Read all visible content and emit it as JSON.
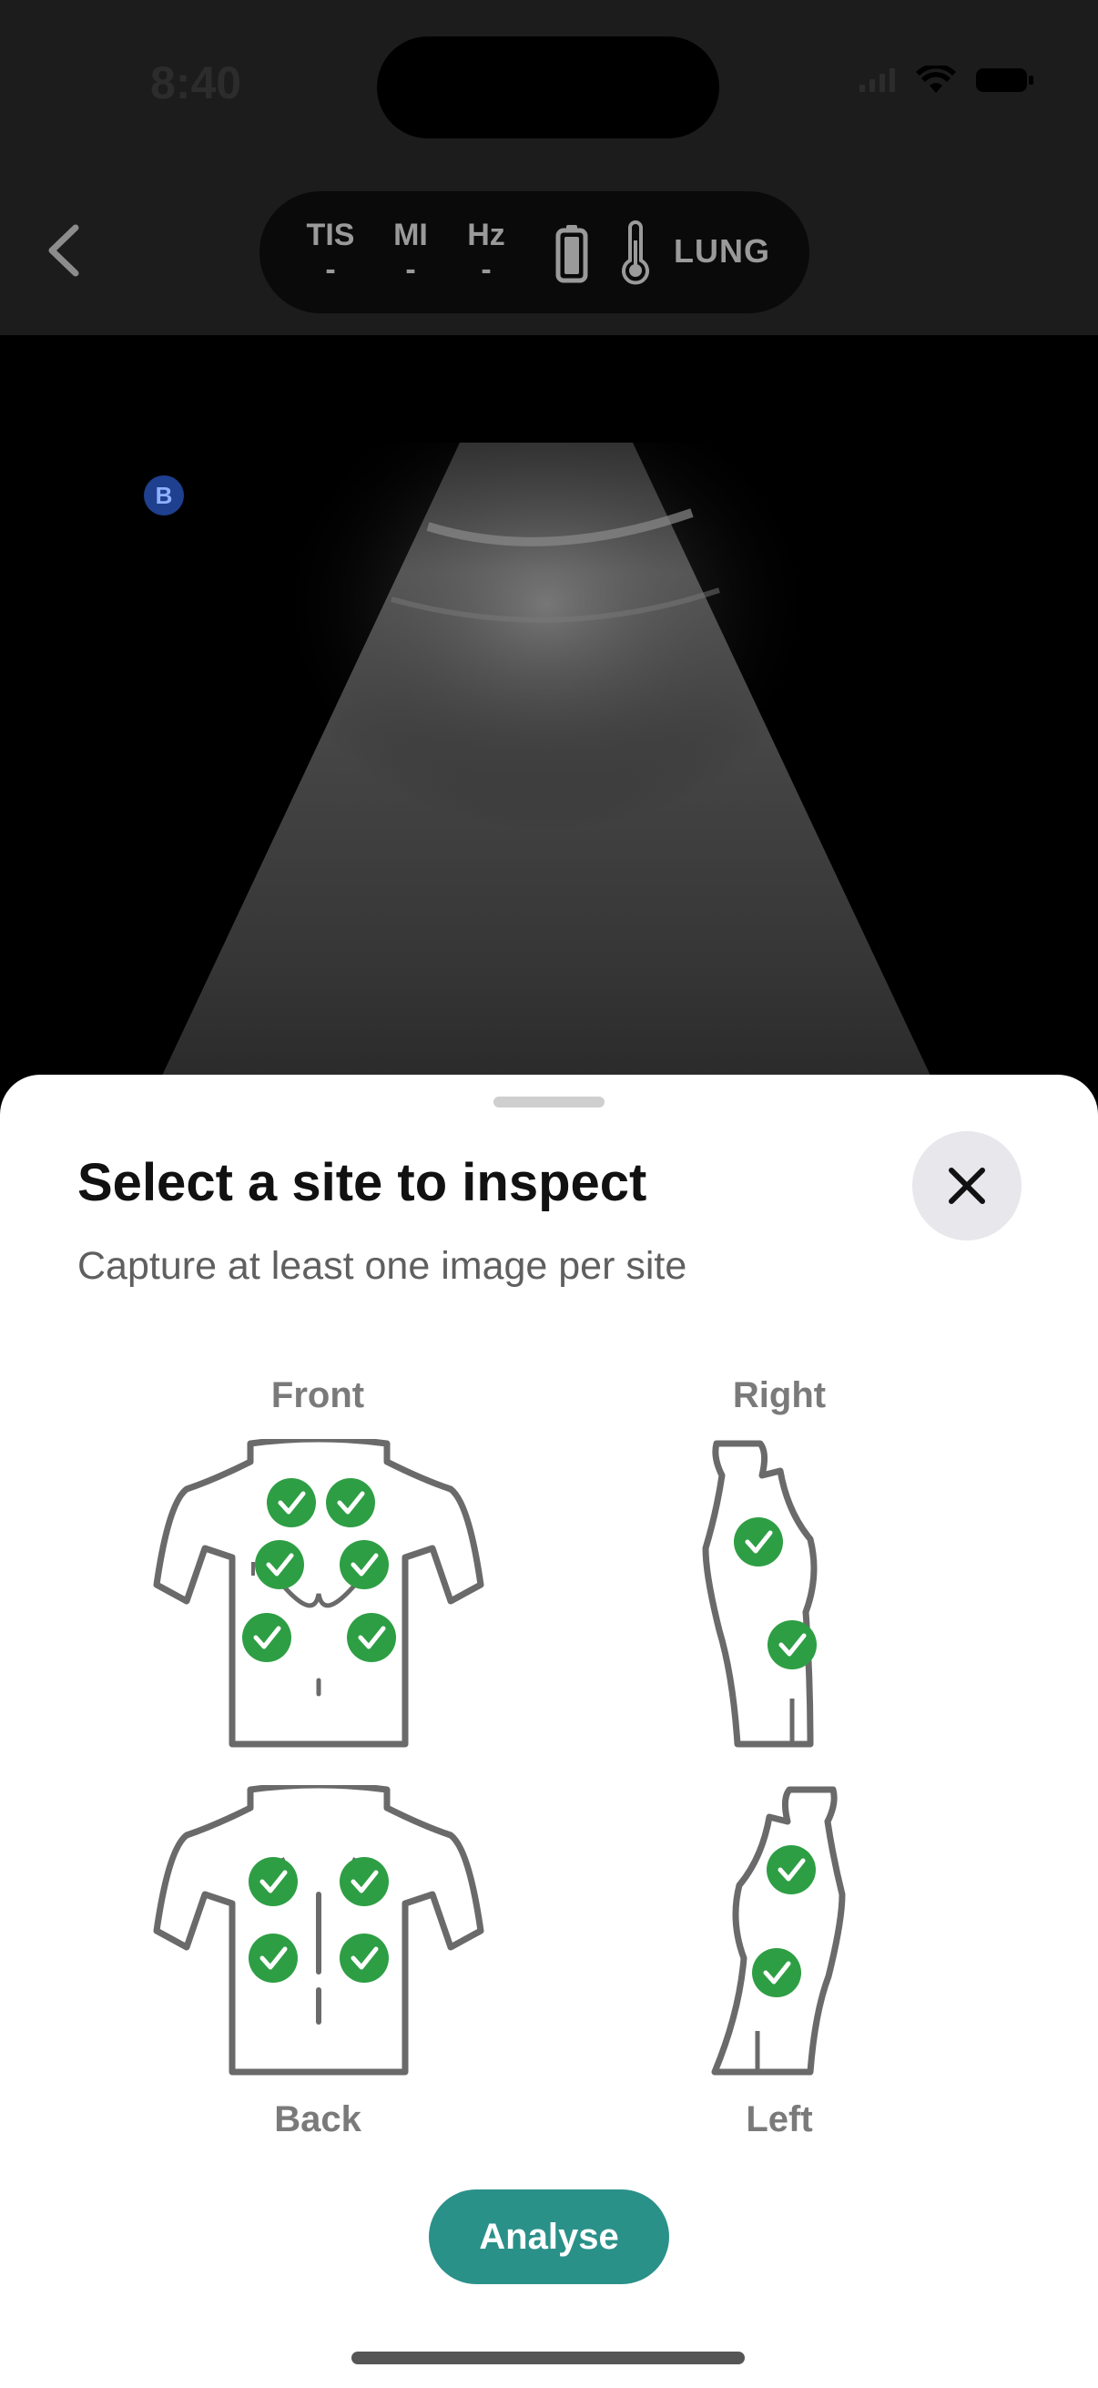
{
  "status_bar": {
    "time": "8:40",
    "icons": [
      "signal-icon",
      "wifi-icon",
      "battery-icon"
    ]
  },
  "header": {
    "metrics": [
      {
        "label": "TIS",
        "value": "-"
      },
      {
        "label": "MI",
        "value": "-"
      },
      {
        "label": "Hz",
        "value": "-"
      }
    ],
    "mode": "LUNG"
  },
  "scan": {
    "badge": "B"
  },
  "sheet": {
    "title": "Select a site to inspect",
    "subtitle": "Capture at least one image per site",
    "views": {
      "front": {
        "label": "Front",
        "completed_sites": 6
      },
      "right": {
        "label": "Right",
        "completed_sites": 2
      },
      "back": {
        "label": "Back",
        "completed_sites": 4
      },
      "left": {
        "label": "Left",
        "completed_sites": 2
      }
    },
    "analyse_label": "Analyse"
  },
  "colors": {
    "accent": "#2a9189",
    "check": "#2e9e44",
    "outline": "#6a6a6a"
  }
}
